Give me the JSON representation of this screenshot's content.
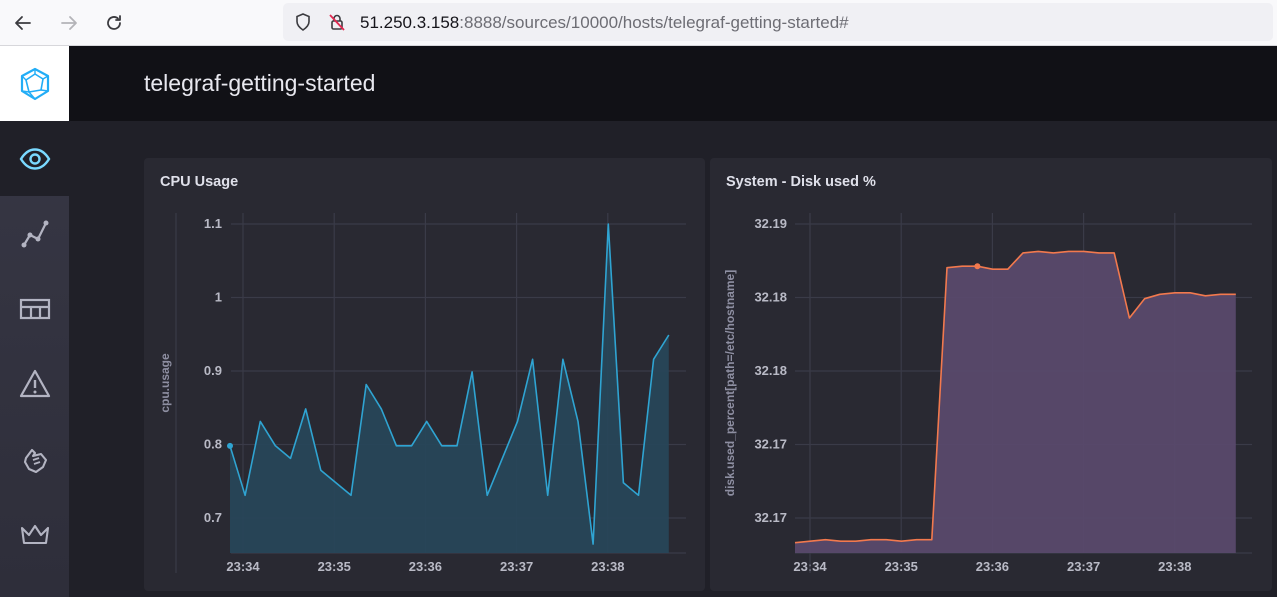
{
  "browser": {
    "url_host": "51.250.3.158",
    "url_rest": ":8888/sources/10000/hosts/telegraf-getting-started#"
  },
  "sidebar": {
    "items": [
      {
        "name": "host-list",
        "icon": "eye-icon",
        "active": true
      },
      {
        "name": "data-explorer",
        "icon": "graph-icon"
      },
      {
        "name": "dashboards",
        "icon": "dashboard-icon"
      },
      {
        "name": "alerting",
        "icon": "alert-icon"
      },
      {
        "name": "log-viewer",
        "icon": "hand-icon"
      },
      {
        "name": "admin",
        "icon": "crown-icon"
      }
    ]
  },
  "header": {
    "title": "telegraf-getting-started"
  },
  "colors": {
    "cpu_line": "#2fa4d2",
    "cpu_fill": "#27475a",
    "disk_line": "#f2794e",
    "disk_fill": "#5b4a6e"
  },
  "chart_data": [
    {
      "type": "area",
      "title": "CPU Usage",
      "ylabel": "cpu.usage",
      "xlabel": "",
      "x_ticks": [
        "23:34",
        "23:35",
        "23:36",
        "23:37",
        "23:38"
      ],
      "y_ticks": [
        "0.7",
        "0.8",
        "0.9",
        "1",
        "1.1"
      ],
      "ylim": [
        0.655,
        1.115
      ],
      "x_start_time": "23:33:50",
      "x_step_seconds": 10,
      "series": [
        {
          "name": "",
          "values": [
            0.8,
            0.733,
            0.833,
            0.8,
            0.783,
            0.85,
            0.767,
            0.75,
            0.733,
            0.883,
            0.85,
            0.8,
            0.8,
            0.833,
            0.8,
            0.8,
            0.9,
            0.733,
            0.783,
            0.833,
            0.917,
            0.733,
            0.917,
            0.833,
            0.667,
            1.1,
            0.75,
            0.733,
            0.917,
            0.95
          ]
        }
      ]
    },
    {
      "type": "area",
      "title": "System - Disk used %",
      "ylabel": "disk.used_percent[path=/etc/hostname]",
      "xlabel": "",
      "x_ticks": [
        "23:34",
        "23:35",
        "23:36",
        "23:37",
        "23:38"
      ],
      "y_ticks": [
        "32.17",
        "32.17",
        "32.18",
        "32.18",
        "32.19"
      ],
      "ylim": [
        32.1664,
        32.1894
      ],
      "x_start_time": "23:33:50",
      "x_step_seconds": 10,
      "series": [
        {
          "name": "",
          "values": [
            32.1671,
            32.1672,
            32.1673,
            32.1672,
            32.1672,
            32.1673,
            32.1673,
            32.1672,
            32.1673,
            32.1673,
            32.1857,
            32.1858,
            32.1858,
            32.1856,
            32.1856,
            32.1867,
            32.1868,
            32.1867,
            32.1868,
            32.1868,
            32.1867,
            32.1867,
            32.1823,
            32.1836,
            32.1839,
            32.184,
            32.184,
            32.1838,
            32.1839,
            32.1839
          ]
        }
      ]
    }
  ]
}
